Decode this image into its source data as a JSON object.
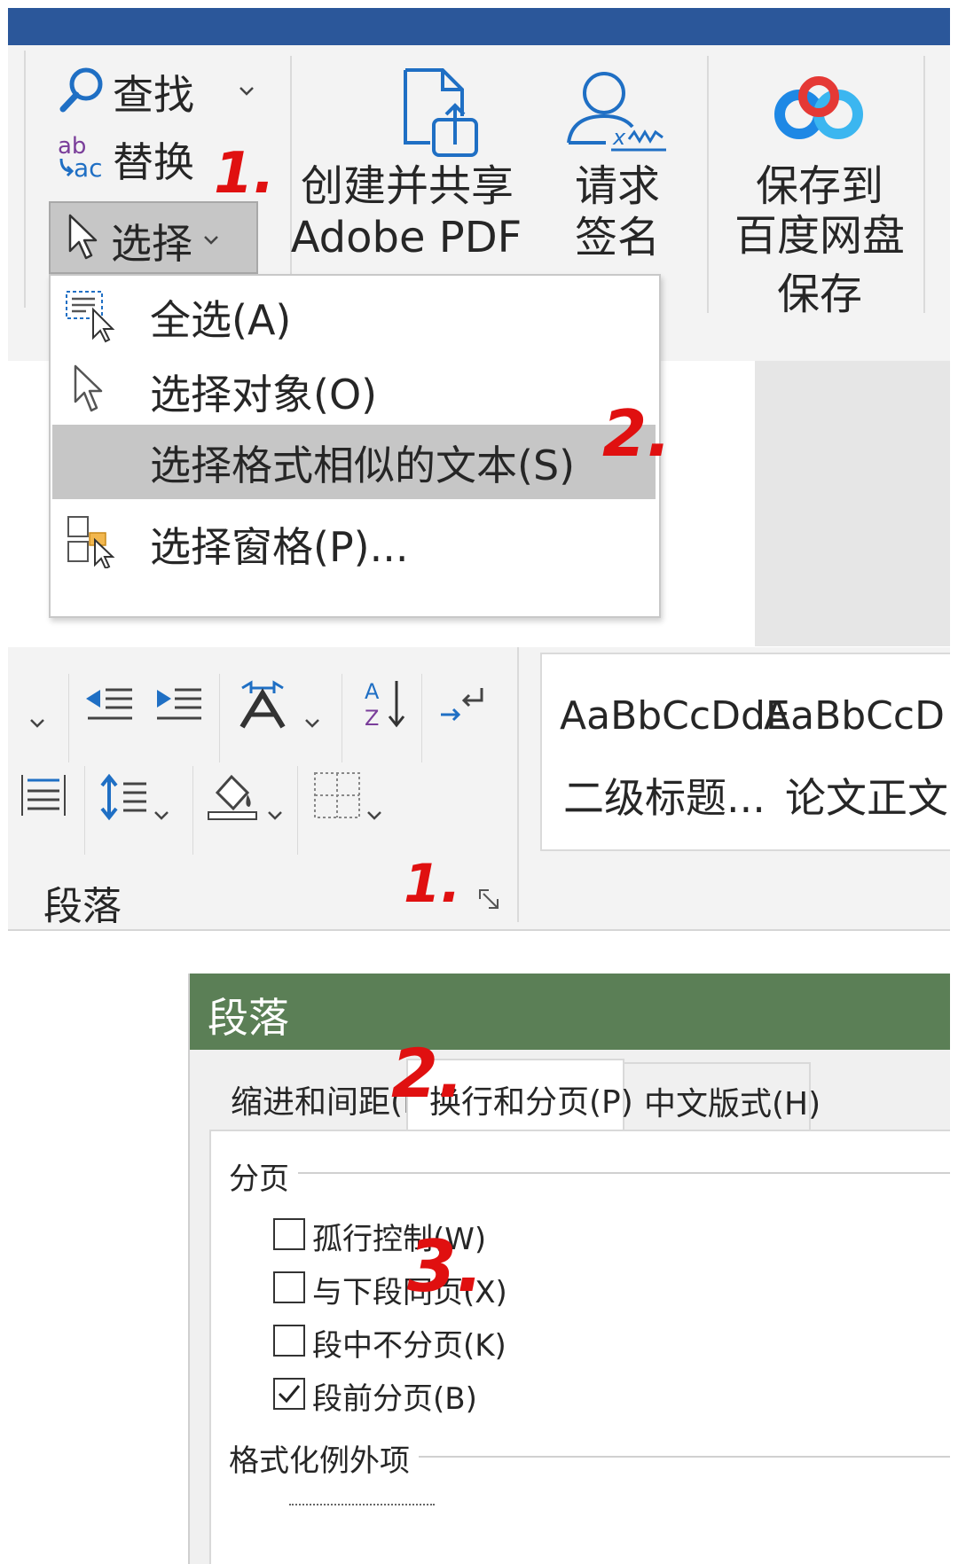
{
  "panel1": {
    "editing_group": {
      "find_label": "查找",
      "replace_label": "替换",
      "select_label": "选择"
    },
    "adobe_group": {
      "create_share_line1": "创建并共享",
      "create_share_line2": "Adobe PDF",
      "request_sign_line1": "请求",
      "request_sign_line2": "签名"
    },
    "baidu_group": {
      "save_line1": "保存到",
      "save_line2": "百度网盘",
      "group_label": "保存"
    },
    "select_menu": {
      "items": [
        {
          "label": "全选(A)",
          "icon": "select-all-icon",
          "highlighted": false
        },
        {
          "label": "选择对象(O)",
          "icon": "pointer-icon",
          "highlighted": false
        },
        {
          "label": "选择格式相似的文本(S)",
          "icon": "",
          "highlighted": true
        },
        {
          "label": "选择窗格(P)...",
          "icon": "selection-pane-icon",
          "highlighted": false
        }
      ]
    },
    "annotations": {
      "step1": "1.",
      "step2": "2."
    }
  },
  "panel2": {
    "group_label": "段落",
    "styles": [
      {
        "preview": "AaBbCcDdE",
        "name": "二级标题..."
      },
      {
        "preview": "AaBbCcD",
        "name": "论文正文"
      }
    ],
    "annotation": "1."
  },
  "panel3": {
    "dialog_title": "段落",
    "tabs": [
      "缩进和间距(I)",
      "换行和分页(P)",
      "中文版式(H)"
    ],
    "active_tab": 1,
    "pagination": {
      "group_label": "分页",
      "options": [
        {
          "label": "孤行控制(W)",
          "checked": false
        },
        {
          "label": "与下段同页(X)",
          "checked": false
        },
        {
          "label": "段中不分页(K)",
          "checked": false
        },
        {
          "label": "段前分页(B)",
          "checked": true
        }
      ]
    },
    "exceptions_label": "格式化例外项",
    "annotations": {
      "step2": "2.",
      "step3": "3."
    }
  },
  "colors": {
    "title_bar": "#2b579a",
    "dialog_title": "#5b7f56",
    "ribbon": "#f3f3f3",
    "highlight": "#c6c6c6",
    "annotation_red": "#e01010",
    "icon_blue": "#1f6fc4"
  }
}
